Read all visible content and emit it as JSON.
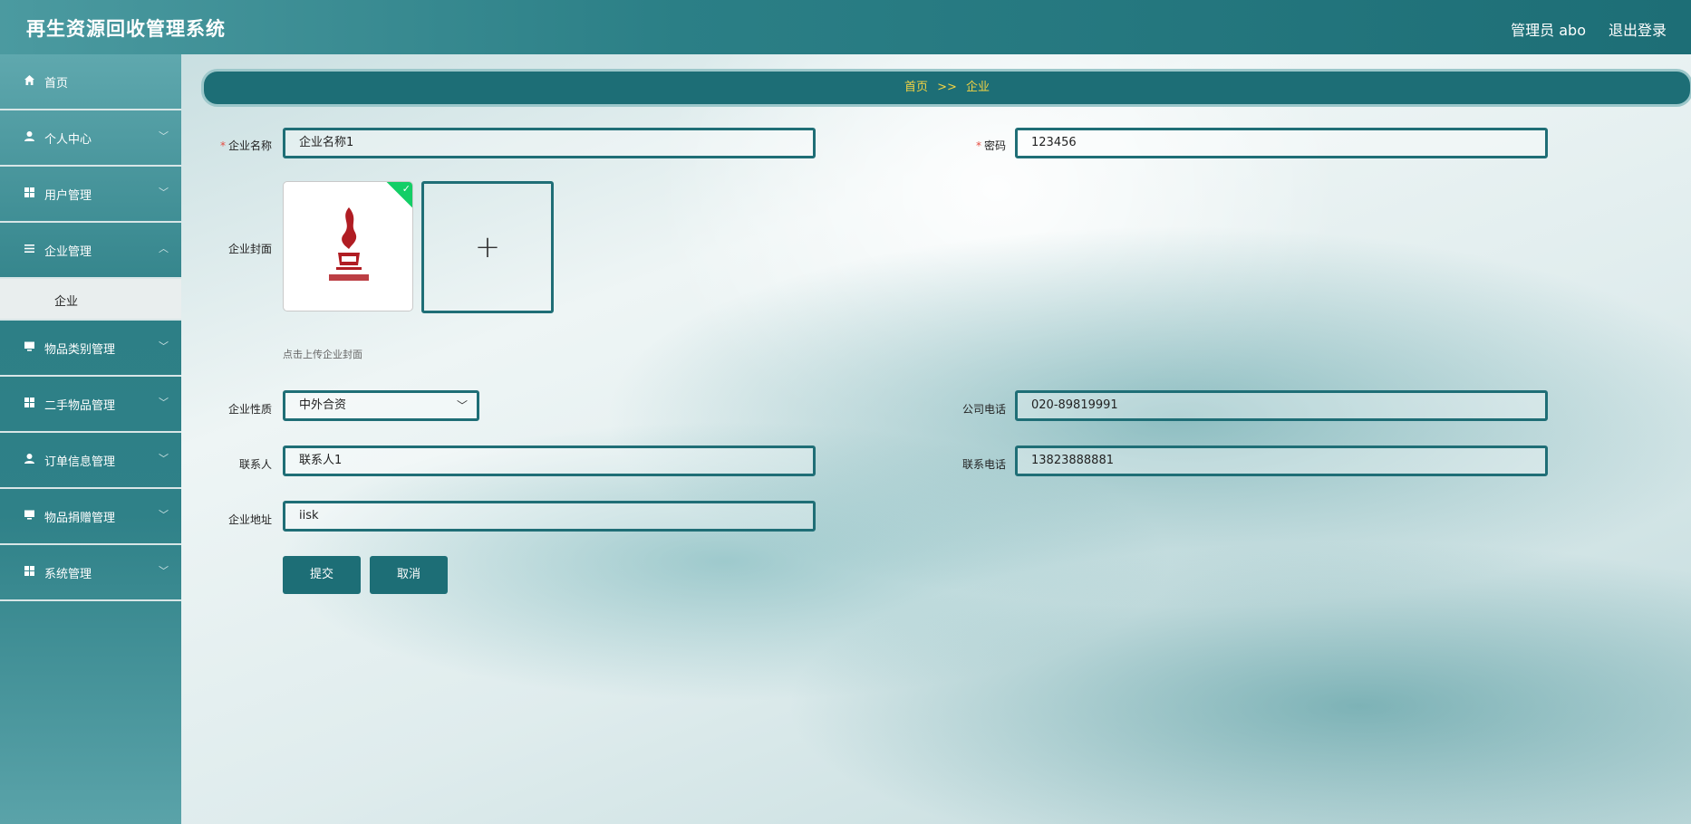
{
  "header": {
    "title": "再生资源回收管理系统",
    "admin": "管理员 abo",
    "logout": "退出登录"
  },
  "sidebar": {
    "items": [
      {
        "label": "首页",
        "icon": "home-icon"
      },
      {
        "label": "个人中心",
        "icon": "user-icon"
      },
      {
        "label": "用户管理",
        "icon": "grid-icon"
      },
      {
        "label": "企业管理",
        "icon": "list-icon"
      },
      {
        "label": "物品类别管理",
        "icon": "monitor-icon"
      },
      {
        "label": "二手物品管理",
        "icon": "grid-icon"
      },
      {
        "label": "订单信息管理",
        "icon": "user-icon"
      },
      {
        "label": "物品捐赠管理",
        "icon": "monitor-icon"
      },
      {
        "label": "系统管理",
        "icon": "grid-icon"
      }
    ],
    "sub_item": "企业"
  },
  "breadcrumb": {
    "home": "首页",
    "sep": ">>",
    "current": "企业"
  },
  "form": {
    "name_label": "企业名称",
    "name_value": "企业名称1",
    "password_label": "密码",
    "password_value": "123456",
    "cover_label": "企业封面",
    "cover_hint": "点击上传企业封面",
    "nature_label": "企业性质",
    "nature_value": "中外合资",
    "phone_label": "公司电话",
    "phone_value": "020-89819991",
    "contact_label": "联系人",
    "contact_value": "联系人1",
    "mobile_label": "联系电话",
    "mobile_value": "13823888881",
    "address_label": "企业地址",
    "address_value": "iisk",
    "submit": "提交",
    "cancel": "取消"
  },
  "colors": {
    "primary": "#1d6e76",
    "breadcrumb_text": "#f3d343",
    "required": "#e54d42",
    "success_badge": "#13ce66"
  }
}
